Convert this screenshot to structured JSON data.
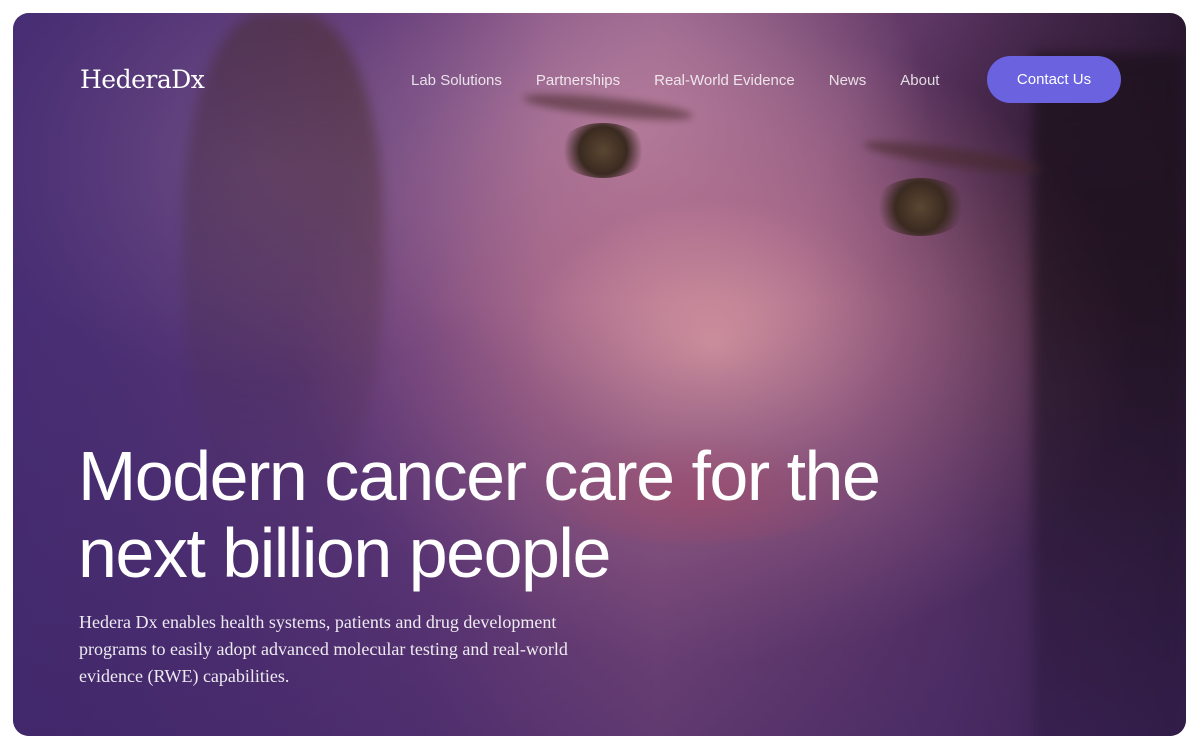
{
  "brand": {
    "logo_text": "HederaDx"
  },
  "nav": {
    "items": [
      {
        "label": "Lab Solutions"
      },
      {
        "label": "Partnerships"
      },
      {
        "label": "Real-World Evidence"
      },
      {
        "label": "News"
      },
      {
        "label": "About"
      }
    ],
    "cta_label": "Contact Us"
  },
  "hero": {
    "headline": "Modern cancer care for the next billion people",
    "subtext": "Hedera Dx enables health systems, patients and drug development programs to easily adopt advanced molecular testing and real-world evidence (RWE) capabilities."
  },
  "colors": {
    "accent_button": "#6b62e0",
    "hero_tint": "#4a2e6e",
    "text": "#ffffff"
  }
}
